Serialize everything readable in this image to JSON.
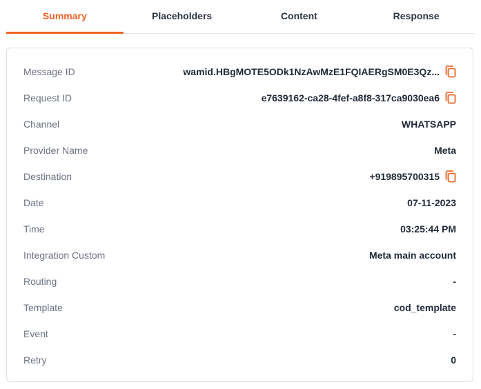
{
  "tabs": [
    {
      "label": "Summary",
      "active": true
    },
    {
      "label": "Placeholders",
      "active": false
    },
    {
      "label": "Content",
      "active": false
    },
    {
      "label": "Response",
      "active": false
    }
  ],
  "summary": {
    "rows": [
      {
        "label": "Message ID",
        "value": "wamid.HBgMOTE5ODk1NzAwMzE1FQIAERgSM0E3Qz...",
        "copy": true
      },
      {
        "label": "Request ID",
        "value": "e7639162-ca28-4fef-a8f8-317ca9030ea6",
        "copy": true
      },
      {
        "label": "Channel",
        "value": "WHATSAPP",
        "copy": false
      },
      {
        "label": "Provider Name",
        "value": "Meta",
        "copy": false
      },
      {
        "label": "Destination",
        "value": "+919895700315",
        "copy": true
      },
      {
        "label": "Date",
        "value": "07-11-2023",
        "copy": false
      },
      {
        "label": "Time",
        "value": "03:25:44 PM",
        "copy": false
      },
      {
        "label": "Integration Custom",
        "value": "Meta main account",
        "copy": false
      },
      {
        "label": "Routing",
        "value": "-",
        "copy": false
      },
      {
        "label": "Template",
        "value": "cod_template",
        "copy": false
      },
      {
        "label": "Event",
        "value": "-",
        "copy": false
      },
      {
        "label": "Retry",
        "value": "0",
        "copy": false
      }
    ]
  },
  "icons": {
    "copy": "copy-icon"
  },
  "colors": {
    "accent": "#f06424",
    "label": "#6b7280",
    "value": "#1f2937"
  }
}
